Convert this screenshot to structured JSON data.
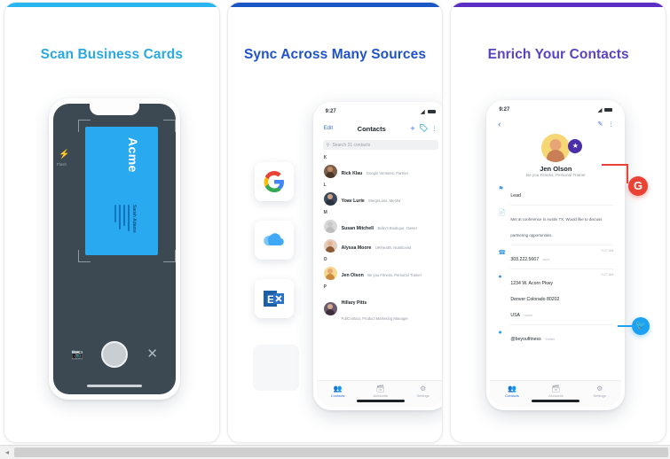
{
  "panels": [
    {
      "title": "Scan Business Cards",
      "accent_color": "#29b6f0",
      "title_color": "#29a9e0",
      "card": {
        "logo": "Acme",
        "name": "Sarah Adams",
        "lines": [
          "",
          "",
          "",
          ""
        ]
      },
      "controls": {
        "gallery_icon": "gallery-icon",
        "shutter_label": "shutter-button",
        "close_icon": "close-icon",
        "flash_label": "Flash"
      }
    },
    {
      "title": "Sync Across Many Sources",
      "accent_color": "#1a56c4",
      "title_color": "#1f52c9",
      "status_time": "9:27",
      "nav": {
        "edit": "Edit",
        "title": "Contacts",
        "plus": "+",
        "tag_icon": "tag-icon",
        "more": "more-icon"
      },
      "search_placeholder": "Search 21 contacts",
      "sections": [
        {
          "letter": "K",
          "contacts": [
            {
              "name": "Rick Klau",
              "sub": "Google Ventures, Partner",
              "avatar_bg": "#7b5e4a",
              "skin": "#c08a63",
              "hair": "#4a3527"
            }
          ]
        },
        {
          "letter": "L",
          "contacts": [
            {
              "name": "Yoav Lurie",
              "sub": "MergeLane, Mentor",
              "avatar_bg": "#3d4a5c",
              "skin": "#caa184",
              "hair": "#2b3340"
            }
          ]
        },
        {
          "letter": "M",
          "contacts": [
            {
              "name": "Susan Mitchell",
              "sub": "Bella's Boutique, Owner",
              "avatar_bg": "#d8d8d8",
              "skin": "#c9c9c9",
              "hair": "#bdbdbd"
            },
            {
              "name": "Alyssa Moore",
              "sub": "URHealth, Nutritionist",
              "avatar_bg": "#e6cdbb",
              "skin": "#e3b391",
              "hair": "#8a5a34"
            }
          ]
        },
        {
          "letter": "O",
          "contacts": [
            {
              "name": "Jen Olson",
              "sub": "Be you Fitness, Personal Trainer",
              "avatar_bg": "#f5d98e",
              "skin": "#e8a678",
              "hair": "#c98a3e"
            }
          ]
        },
        {
          "letter": "P",
          "contacts": [
            {
              "name": "Hillary Pitts",
              "sub": "FullContact, Product Marketing Manager",
              "avatar_bg": "#6b5a6e",
              "skin": "#d6a98c",
              "hair": "#3f2f3c"
            }
          ]
        }
      ],
      "tabs": [
        {
          "label": "Contacts",
          "icon": "contacts-icon",
          "active": true
        },
        {
          "label": "Accounts",
          "icon": "accounts-icon",
          "active": false
        },
        {
          "label": "Settings",
          "icon": "settings-icon",
          "active": false
        }
      ],
      "sources": [
        {
          "name": "google-source-icon",
          "glyph": "G"
        },
        {
          "name": "icloud-source-icon",
          "glyph": "☁"
        },
        {
          "name": "exchange-source-icon",
          "glyph": "E"
        }
      ]
    },
    {
      "title": "Enrich Your Contacts",
      "accent_color": "#5b2fc6",
      "title_color": "#5a42c4",
      "status_time": "9:27",
      "nav": {
        "back": "‹",
        "edit_icon": "edit-icon",
        "more": "more-icon"
      },
      "contact": {
        "name": "Jen Olson",
        "sub": "Be you Fitness, Personal Trainer",
        "badge_icon": "enrich-badge-icon"
      },
      "details": [
        {
          "icon": "tag-icon",
          "value": "Lead",
          "label": "",
          "time": ""
        },
        {
          "icon": "note-icon",
          "value": "Met at conference in Austin TX. Would like to discuss partnering opportunities.",
          "label": "",
          "time": ""
        },
        {
          "icon": "phone-icon",
          "value": "303.222.5667",
          "label": "work",
          "time": "9:27 AM"
        },
        {
          "icon": "location-icon",
          "value": "1234 W. Acorn Pkwy\nDenver Colorado 80202\nUSA",
          "label": "home",
          "time": "9:27 AM"
        },
        {
          "icon": "twitter-icon",
          "value": "@beyoufitness",
          "label": "Twitter",
          "time": ""
        }
      ],
      "enrich_sources": [
        {
          "name": "google-enrich-icon",
          "glyph": "G",
          "color": "#ea4335"
        },
        {
          "name": "twitter-enrich-icon",
          "glyph": "𝕥",
          "color": "#1da1f2"
        }
      ],
      "tabs": [
        {
          "label": "Contacts",
          "icon": "contacts-icon",
          "active": true
        },
        {
          "label": "Accounts",
          "icon": "accounts-icon",
          "active": false
        },
        {
          "label": "Settings",
          "icon": "settings-icon",
          "active": false
        }
      ]
    }
  ],
  "scrollbar": {
    "left_arrow": "◂"
  }
}
